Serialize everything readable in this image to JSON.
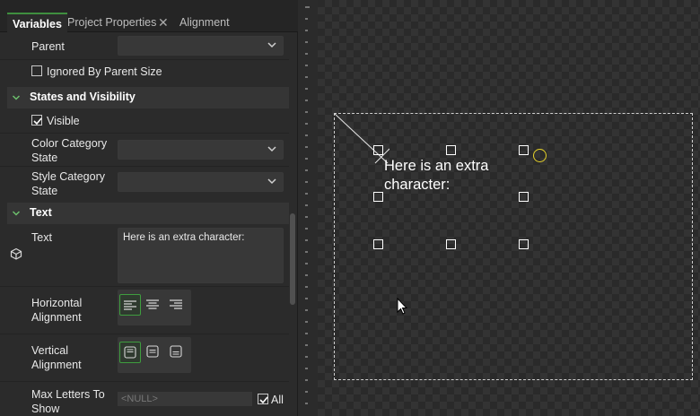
{
  "tabs": [
    {
      "label": "Variables"
    },
    {
      "label": "Project Properties",
      "close_glyph": "✕"
    },
    {
      "label": "Alignment"
    }
  ],
  "properties": {
    "parent_label": "Parent",
    "ignored_by_parent_size_label": "Ignored By Parent Size",
    "ignored_by_parent_size_checked": false,
    "section_states": "States and Visibility",
    "visible_label": "Visible",
    "visible_checked": true,
    "color_category_state_label": "Color Category State",
    "style_category_state_label": "Style Category State",
    "section_text": "Text",
    "text_label": "Text",
    "text_value": "Here is an extra character:",
    "horizontal_alignment_label": "Horizontal Alignment",
    "horizontal_alignment_selected": "left",
    "vertical_alignment_label": "Vertical Alignment",
    "vertical_alignment_selected": "top",
    "max_letters_label": "Max Letters To Show",
    "max_letters_value": "<NULL>",
    "all_label": "All",
    "all_checked": true
  },
  "canvas": {
    "text": "Here is an extra character:"
  },
  "icons": {
    "text_type_icon": "cube-icon",
    "dropdown_icon": "chevron-down-icon",
    "section_icon": "chevron-down-icon"
  },
  "colors": {
    "accent_green": "#3f9d3f",
    "rotation_handle": "#e6d229"
  }
}
